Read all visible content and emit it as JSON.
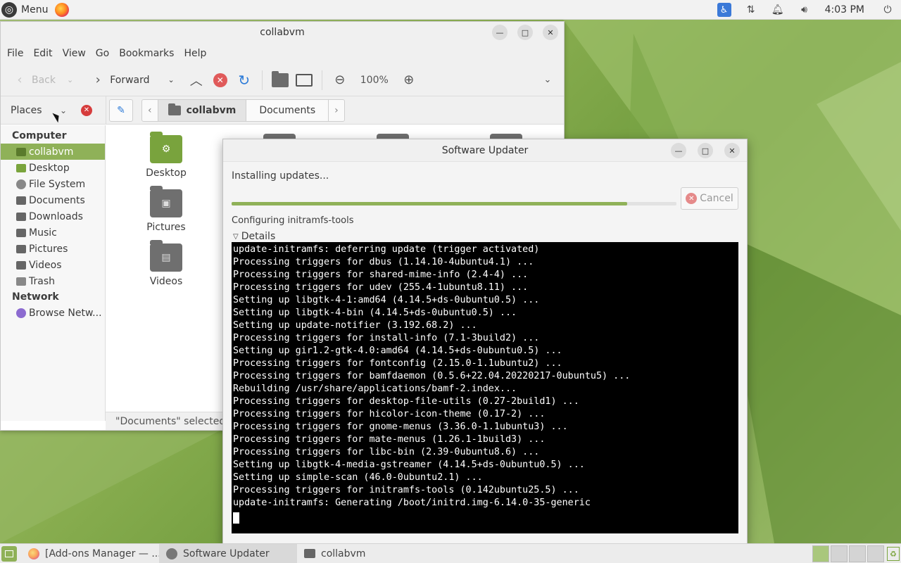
{
  "top_panel": {
    "menu_label": "Menu",
    "clock": "4:03 PM"
  },
  "file_manager": {
    "title": "collabvm",
    "menus": [
      "File",
      "Edit",
      "View",
      "Go",
      "Bookmarks",
      "Help"
    ],
    "toolbar": {
      "back": "Back",
      "forward": "Forward",
      "zoom": "100%"
    },
    "places_label": "Places",
    "breadcrumbs": [
      "collabvm",
      "Documents"
    ],
    "sidebar": {
      "computer_heading": "Computer",
      "computer_items": [
        "collabvm",
        "Desktop",
        "File System",
        "Documents",
        "Downloads",
        "Music",
        "Pictures",
        "Videos",
        "Trash"
      ],
      "network_heading": "Network",
      "network_items": [
        "Browse Netw..."
      ]
    },
    "tiles": [
      "Desktop",
      "Pictures",
      "Videos"
    ],
    "status": "\"Documents\" selected ("
  },
  "software_updater": {
    "title": "Software Updater",
    "status": "Installing updates...",
    "progress": 0.89,
    "cancel_label": "Cancel",
    "sub_status": "Configuring initramfs-tools",
    "details_label": "Details",
    "terminal_lines": [
      "update-initramfs: deferring update (trigger activated)",
      "Processing triggers for dbus (1.14.10-4ubuntu4.1) ...",
      "Processing triggers for shared-mime-info (2.4-4) ...",
      "Processing triggers for udev (255.4-1ubuntu8.11) ...",
      "Setting up libgtk-4-1:amd64 (4.14.5+ds-0ubuntu0.5) ...",
      "Setting up libgtk-4-bin (4.14.5+ds-0ubuntu0.5) ...",
      "Setting up update-notifier (3.192.68.2) ...",
      "Processing triggers for install-info (7.1-3build2) ...",
      "Setting up gir1.2-gtk-4.0:amd64 (4.14.5+ds-0ubuntu0.5) ...",
      "Processing triggers for fontconfig (2.15.0-1.1ubuntu2) ...",
      "Processing triggers for bamfdaemon (0.5.6+22.04.20220217-0ubuntu5) ...",
      "Rebuilding /usr/share/applications/bamf-2.index...",
      "Processing triggers for desktop-file-utils (0.27-2build1) ...",
      "Processing triggers for hicolor-icon-theme (0.17-2) ...",
      "Processing triggers for gnome-menus (3.36.0-1.1ubuntu3) ...",
      "Processing triggers for mate-menus (1.26.1-1build3) ...",
      "Processing triggers for libc-bin (2.39-0ubuntu8.6) ...",
      "Setting up libgtk-4-media-gstreamer (4.14.5+ds-0ubuntu0.5) ...",
      "Setting up simple-scan (46.0-0ubuntu2.1) ...",
      "Processing triggers for initramfs-tools (0.142ubuntu25.5) ...",
      "update-initramfs: Generating /boot/initrd.img-6.14.0-35-generic"
    ]
  },
  "taskbar": {
    "tasks": [
      "[Add-ons Manager — ...",
      "Software Updater",
      "collabvm"
    ]
  },
  "colors": {
    "accent": "#8fb158",
    "terminal_bg": "#000000"
  },
  "icons": {
    "menu": "ubuntu-logo-icon",
    "firefox": "firefox-icon",
    "accessibility": "accessibility-icon"
  }
}
